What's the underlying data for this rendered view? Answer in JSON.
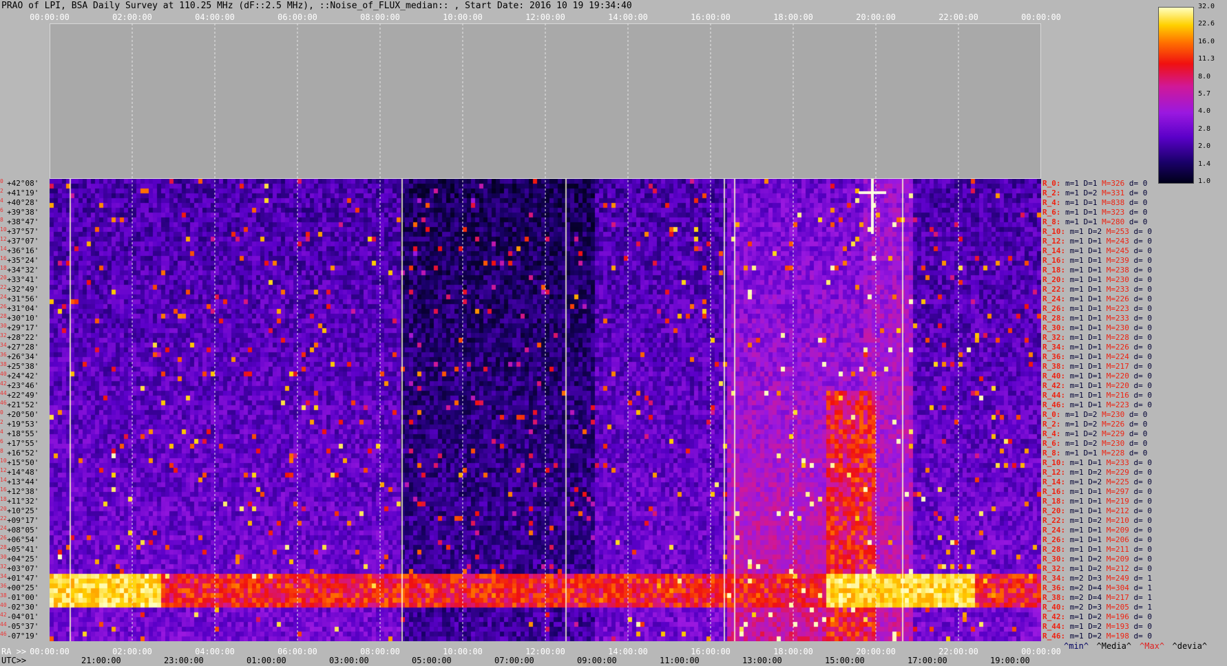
{
  "title": "PRAO of LPI, BSA Daily Survey at 110.25 MHz (dF::2.5 MHz), ::Noise_of_FLUX_median:: , Start Date: 2016 10 19 19:34:40",
  "top_axis_ticks": [
    "00:00:00",
    "02:00:00",
    "04:00:00",
    "06:00:00",
    "08:00:00",
    "10:00:00",
    "12:00:00",
    "14:00:00",
    "16:00:00",
    "18:00:00",
    "20:00:00",
    "22:00:00",
    "00:00:00"
  ],
  "ra_label": "RA >>",
  "utc_label": "UTC>>",
  "ra_ticks": [
    "00:00:00",
    "02:00:00",
    "04:00:00",
    "06:00:00",
    "08:00:00",
    "10:00:00",
    "12:00:00",
    "14:00:00",
    "16:00:00",
    "18:00:00",
    "20:00:00",
    "22:00:00",
    "00:00:00"
  ],
  "utc_ticks": [
    "21:00:00",
    "23:00:00",
    "01:00:00",
    "03:00:00",
    "05:00:00",
    "07:00:00",
    "09:00:00",
    "11:00:00",
    "13:00:00",
    "15:00:00",
    "17:00:00",
    "19:00:00"
  ],
  "colorbar_labels": [
    "32.0",
    "22.6",
    "16.0",
    "11.3",
    "8.0",
    "5.7",
    "4.0",
    "2.8",
    "2.0",
    "1.4",
    "1.0"
  ],
  "legend": [
    {
      "text": "^min^",
      "color": "#000060"
    },
    {
      "text": "^Media^",
      "color": "#000000"
    },
    {
      "text": "^Max^",
      "color": "#e02020"
    },
    {
      "text": "^devia^",
      "color": "#000000"
    }
  ],
  "dec_rows": [
    {
      "i": "0",
      "d": "+42°08'"
    },
    {
      "i": "2",
      "d": "+41°19'"
    },
    {
      "i": "4",
      "d": "+40°28'"
    },
    {
      "i": "6",
      "d": "+39°38'"
    },
    {
      "i": "8",
      "d": "+38°47'"
    },
    {
      "i": "10",
      "d": "+37°57'"
    },
    {
      "i": "12",
      "d": "+37°07'"
    },
    {
      "i": "14",
      "d": "+36°16'"
    },
    {
      "i": "16",
      "d": "+35°24'"
    },
    {
      "i": "18",
      "d": "+34°32'"
    },
    {
      "i": "20",
      "d": "+33°41'"
    },
    {
      "i": "22",
      "d": "+32°49'"
    },
    {
      "i": "24",
      "d": "+31°56'"
    },
    {
      "i": "26",
      "d": "+31°04'"
    },
    {
      "i": "28",
      "d": "+30°10'"
    },
    {
      "i": "30",
      "d": "+29°17'"
    },
    {
      "i": "32",
      "d": "+28°22'"
    },
    {
      "i": "34",
      "d": "+27°28'"
    },
    {
      "i": "36",
      "d": "+26°34'"
    },
    {
      "i": "38",
      "d": "+25°38'"
    },
    {
      "i": "40",
      "d": "+24°42'"
    },
    {
      "i": "42",
      "d": "+23°46'"
    },
    {
      "i": "44",
      "d": "+22°49'"
    },
    {
      "i": "46",
      "d": "+21°52'"
    },
    {
      "i": "0",
      "d": "+20°50'"
    },
    {
      "i": "2",
      "d": "+19°53'"
    },
    {
      "i": "4",
      "d": "+18°55'"
    },
    {
      "i": "6",
      "d": "+17°55'"
    },
    {
      "i": "8",
      "d": "+16°52'"
    },
    {
      "i": "10",
      "d": "+15°50'"
    },
    {
      "i": "12",
      "d": "+14°48'"
    },
    {
      "i": "14",
      "d": "+13°44'"
    },
    {
      "i": "16",
      "d": "+12°38'"
    },
    {
      "i": "18",
      "d": "+11°32'"
    },
    {
      "i": "20",
      "d": "+10°25'"
    },
    {
      "i": "22",
      "d": "+09°17'"
    },
    {
      "i": "24",
      "d": "+08°05'"
    },
    {
      "i": "26",
      "d": "+06°54'"
    },
    {
      "i": "28",
      "d": "+05°41'"
    },
    {
      "i": "30",
      "d": "+04°25'"
    },
    {
      "i": "32",
      "d": "+03°07'"
    },
    {
      "i": "34",
      "d": "+01°47'"
    },
    {
      "i": "36",
      "d": "+00°25'"
    },
    {
      "i": "38",
      "d": "-01°00'"
    },
    {
      "i": "40",
      "d": "-02°30'"
    },
    {
      "i": "42",
      "d": "-04°01'"
    },
    {
      "i": "44",
      "d": "-05°37'"
    },
    {
      "i": "46",
      "d": "-07°19'"
    }
  ],
  "stat_rows": [
    {
      "r": "R_0:",
      "m": "m=1",
      "D": "D=1",
      "M": "M=326",
      "d": "d= 0"
    },
    {
      "r": "R_2:",
      "m": "m=1",
      "D": "D=2",
      "M": "M=331",
      "d": "d= 0"
    },
    {
      "r": "R_4:",
      "m": "m=1",
      "D": "D=1",
      "M": "M=838",
      "d": "d= 0"
    },
    {
      "r": "R_6:",
      "m": "m=1",
      "D": "D=1",
      "M": "M=323",
      "d": "d= 0"
    },
    {
      "r": "R_8:",
      "m": "m=1",
      "D": "D=1",
      "M": "M=280",
      "d": "d= 0"
    },
    {
      "r": "R_10:",
      "m": "m=1",
      "D": "D=2",
      "M": "M=253",
      "d": "d= 0"
    },
    {
      "r": "R_12:",
      "m": "m=1",
      "D": "D=1",
      "M": "M=243",
      "d": "d= 0"
    },
    {
      "r": "R_14:",
      "m": "m=1",
      "D": "D=1",
      "M": "M=245",
      "d": "d= 0"
    },
    {
      "r": "R_16:",
      "m": "m=1",
      "D": "D=1",
      "M": "M=239",
      "d": "d= 0"
    },
    {
      "r": "R_18:",
      "m": "m=1",
      "D": "D=1",
      "M": "M=238",
      "d": "d= 0"
    },
    {
      "r": "R_20:",
      "m": "m=1",
      "D": "D=1",
      "M": "M=230",
      "d": "d= 0"
    },
    {
      "r": "R_22:",
      "m": "m=1",
      "D": "D=1",
      "M": "M=233",
      "d": "d= 0"
    },
    {
      "r": "R_24:",
      "m": "m=1",
      "D": "D=1",
      "M": "M=226",
      "d": "d= 0"
    },
    {
      "r": "R_26:",
      "m": "m=1",
      "D": "D=1",
      "M": "M=223",
      "d": "d= 0"
    },
    {
      "r": "R_28:",
      "m": "m=1",
      "D": "D=1",
      "M": "M=233",
      "d": "d= 0"
    },
    {
      "r": "R_30:",
      "m": "m=1",
      "D": "D=1",
      "M": "M=230",
      "d": "d= 0"
    },
    {
      "r": "R_32:",
      "m": "m=1",
      "D": "D=1",
      "M": "M=228",
      "d": "d= 0"
    },
    {
      "r": "R_34:",
      "m": "m=1",
      "D": "D=1",
      "M": "M=226",
      "d": "d= 0"
    },
    {
      "r": "R_36:",
      "m": "m=1",
      "D": "D=1",
      "M": "M=224",
      "d": "d= 0"
    },
    {
      "r": "R_38:",
      "m": "m=1",
      "D": "D=1",
      "M": "M=217",
      "d": "d= 0"
    },
    {
      "r": "R_40:",
      "m": "m=1",
      "D": "D=1",
      "M": "M=220",
      "d": "d= 0"
    },
    {
      "r": "R_42:",
      "m": "m=1",
      "D": "D=1",
      "M": "M=220",
      "d": "d= 0"
    },
    {
      "r": "R_44:",
      "m": "m=1",
      "D": "D=1",
      "M": "M=216",
      "d": "d= 0"
    },
    {
      "r": "R_46:",
      "m": "m=1",
      "D": "D=1",
      "M": "M=223",
      "d": "d= 0"
    },
    {
      "r": "R_0:",
      "m": "m=1",
      "D": "D=2",
      "M": "M=230",
      "d": "d= 0"
    },
    {
      "r": "R_2:",
      "m": "m=1",
      "D": "D=2",
      "M": "M=226",
      "d": "d= 0"
    },
    {
      "r": "R_4:",
      "m": "m=1",
      "D": "D=2",
      "M": "M=229",
      "d": "d= 0"
    },
    {
      "r": "R_6:",
      "m": "m=1",
      "D": "D=2",
      "M": "M=230",
      "d": "d= 0"
    },
    {
      "r": "R_8:",
      "m": "m=1",
      "D": "D=1",
      "M": "M=228",
      "d": "d= 0"
    },
    {
      "r": "R_10:",
      "m": "m=1",
      "D": "D=1",
      "M": "M=233",
      "d": "d= 0"
    },
    {
      "r": "R_12:",
      "m": "m=1",
      "D": "D=2",
      "M": "M=229",
      "d": "d= 0"
    },
    {
      "r": "R_14:",
      "m": "m=1",
      "D": "D=2",
      "M": "M=225",
      "d": "d= 0"
    },
    {
      "r": "R_16:",
      "m": "m=1",
      "D": "D=1",
      "M": "M=297",
      "d": "d= 0"
    },
    {
      "r": "R_18:",
      "m": "m=1",
      "D": "D=1",
      "M": "M=219",
      "d": "d= 0"
    },
    {
      "r": "R_20:",
      "m": "m=1",
      "D": "D=1",
      "M": "M=212",
      "d": "d= 0"
    },
    {
      "r": "R_22:",
      "m": "m=1",
      "D": "D=2",
      "M": "M=210",
      "d": "d= 0"
    },
    {
      "r": "R_24:",
      "m": "m=1",
      "D": "D=1",
      "M": "M=209",
      "d": "d= 0"
    },
    {
      "r": "R_26:",
      "m": "m=1",
      "D": "D=1",
      "M": "M=206",
      "d": "d= 0"
    },
    {
      "r": "R_28:",
      "m": "m=1",
      "D": "D=1",
      "M": "M=211",
      "d": "d= 0"
    },
    {
      "r": "R_30:",
      "m": "m=1",
      "D": "D=2",
      "M": "M=209",
      "d": "d= 0"
    },
    {
      "r": "R_32:",
      "m": "m=1",
      "D": "D=2",
      "M": "M=212",
      "d": "d= 0"
    },
    {
      "r": "R_34:",
      "m": "m=2",
      "D": "D=3",
      "M": "M=249",
      "d": "d= 1"
    },
    {
      "r": "R_36:",
      "m": "m=2",
      "D": "D=4",
      "M": "M=304",
      "d": "d= 1"
    },
    {
      "r": "R_38:",
      "m": "m=2",
      "D": "D=4",
      "M": "M=217",
      "d": "d= 1"
    },
    {
      "r": "R_40:",
      "m": "m=2",
      "D": "D=3",
      "M": "M=205",
      "d": "d= 1"
    },
    {
      "r": "R_42:",
      "m": "m=1",
      "D": "D=2",
      "M": "M=196",
      "d": "d= 0"
    },
    {
      "r": "R_44:",
      "m": "m=1",
      "D": "D=2",
      "M": "M=193",
      "d": "d= 0"
    },
    {
      "r": "R_46:",
      "m": "m=1",
      "D": "D=2",
      "M": "M=198",
      "d": "d= 0"
    }
  ]
}
